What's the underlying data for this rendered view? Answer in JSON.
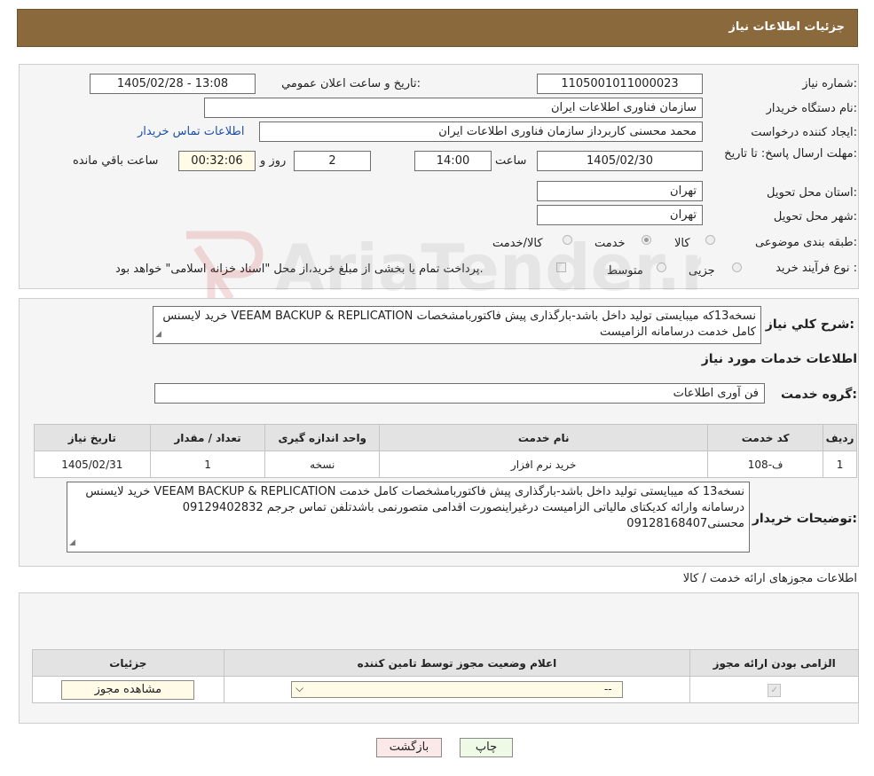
{
  "header": {
    "title": "جزئیات اطلاعات نیاز"
  },
  "form": {
    "need_number_label": "شماره نیاز:",
    "need_number": "1105001011000023",
    "announce_label": "تاریخ و ساعت اعلان عمومي:",
    "announce_value": "1405/02/28 - 13:08",
    "buyer_org_label": "نام دستگاه خريدار:",
    "buyer_org": "سازمان فناوری اطلاعات ایران",
    "creator_label": "ايجاد كننده درخواست:",
    "creator": "محمد محسنی کاربرداز سازمان فناوری اطلاعات ایران",
    "contact_link": "اطلاعات تماس خريدار",
    "deadline_label": "مهلت ارسال پاسخ: تا تاریخ:",
    "deadline_date": "1405/02/30",
    "time_label": "ساعت",
    "deadline_time": "14:00",
    "days": "2",
    "days_label": "روز و",
    "remaining": "00:32:06",
    "remaining_label": "ساعت باقي مانده",
    "province_label": "استان محل تحویل:",
    "province": "تهران",
    "city_label": "شهر محل تحویل:",
    "city": "تهران",
    "category_label": "طبقه بندی موضوعی:",
    "category_options": [
      "کالا",
      "خدمت",
      "کالا/خدمت"
    ],
    "process_label": "نوع فرآیند خرید :",
    "process_options": [
      "جزیی",
      "متوسط"
    ],
    "process_note": "پرداخت تمام یا بخشی از مبلغ خرید،از محل \"اسناد خزانه اسلامی\" خواهد بود."
  },
  "summary": {
    "label": "شرح کلي نياز:",
    "text": "خرید لایسنس VEEAM BACKUP & REPLICATION نسخه13که میبایستی تولید داخل باشد-بارگذاری پیش فاکتوربامشخصات کامل خدمت درسامانه الزامیست"
  },
  "services": {
    "title": "اطلاعات خدمات مورد نیاز",
    "group_label": "گروه خدمت:",
    "group_value": "فن آوری اطلاعات",
    "columns": [
      "ردیف",
      "کد خدمت",
      "نام خدمت",
      "واحد اندازه گیری",
      "تعداد / مقدار",
      "تاریخ نیاز"
    ],
    "rows": [
      [
        "1",
        "ف-108",
        "خرید نرم افزار",
        "نسخه",
        "1",
        "1405/02/31"
      ]
    ]
  },
  "buyer_notes": {
    "label": "توضیحات خریدار:",
    "text": "خرید لایسنس VEEAM BACKUP & REPLICATION نسخه13 که میبایستی تولید داخل باشد-بارگذاری پیش فاکتوربامشخصات کامل خدمت درسامانه وارائه کدیکتای مالیاتی الزامیست درغیراینصورت اقدامی متصورنمی باشدتلفن تماس جرجم 09129402832 محسنی09128168407"
  },
  "permits": {
    "title": "اطلاعات مجوزهای ارائه خدمت / کالا",
    "columns": [
      "الزامی بودن ارائه مجوز",
      "اعلام وضعیت مجوز توسط تامین کننده",
      "جزئیات"
    ],
    "select_value": "--",
    "view_button": "مشاهده مجوز"
  },
  "footer": {
    "print_button": "چاپ",
    "back_button": "بازگشت"
  },
  "watermark": "AriaTender.neT"
}
